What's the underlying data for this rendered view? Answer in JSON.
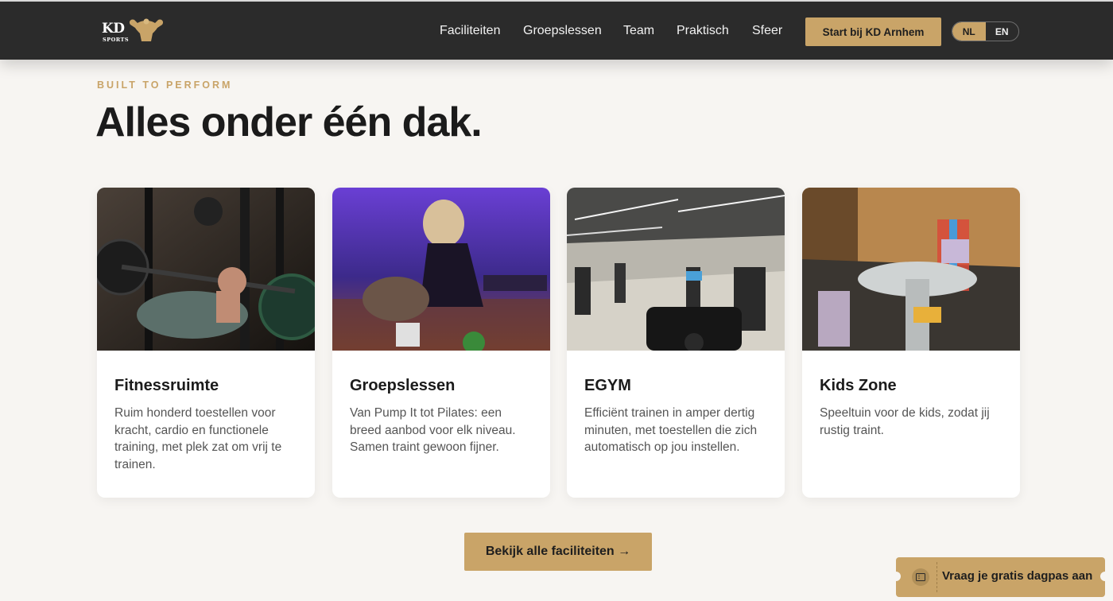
{
  "header": {
    "logo": {
      "kd": "KD",
      "sports": "SPORTS"
    },
    "nav": [
      {
        "label": "Faciliteiten"
      },
      {
        "label": "Groepslessen"
      },
      {
        "label": "Team"
      },
      {
        "label": "Praktisch"
      },
      {
        "label": "Sfeer"
      }
    ],
    "cta_label": "Start bij KD Arnhem",
    "languages": [
      {
        "code": "NL",
        "active": true
      },
      {
        "code": "EN",
        "active": false
      }
    ]
  },
  "section": {
    "eyebrow": "BUILT TO PERFORM",
    "title": "Alles onder één dak."
  },
  "cards": [
    {
      "title": "Fitnessruimte",
      "text": "Ruim honderd toestellen voor kracht, cardio en functionele training, met plek zat om vrij te trainen.",
      "image_icon": "bench-press-photo"
    },
    {
      "title": "Groepslessen",
      "text": "Van Pump It tot Pilates: een breed aanbod voor elk niveau. Samen traint gewoon fijner.",
      "image_icon": "group-class-photo"
    },
    {
      "title": "EGYM",
      "text": "Efficiënt trainen in amper dertig minuten, met toestellen die zich automatisch op jou instellen.",
      "image_icon": "gym-floor-photo"
    },
    {
      "title": "Kids Zone",
      "text": "Speeltuin voor de kids, zodat jij rustig traint.",
      "image_icon": "kids-zone-photo"
    }
  ],
  "main_cta_label": "Bekijk alle faciliteiten →",
  "ticket": {
    "label": "Vraag je gratis dagpas aan",
    "icon": "ticket-icon"
  },
  "colors": {
    "accent": "#c9a468",
    "header_bg": "#2b2b2b",
    "page_bg": "#f7f5f2"
  }
}
